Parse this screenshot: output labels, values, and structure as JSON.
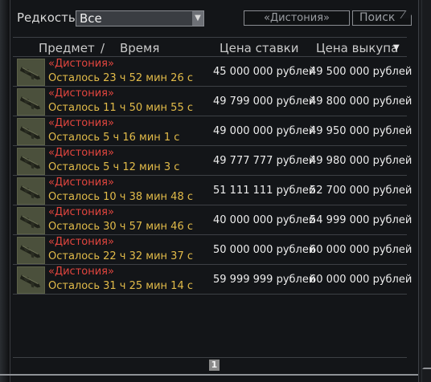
{
  "filters": {
    "rarity_label": "Редкость",
    "rarity_value": "Все",
    "search_value": "«Дистония»",
    "search_button": "Поиск"
  },
  "table": {
    "columns": {
      "item": "Предмет",
      "separator": "/",
      "time": "Время",
      "bid": "Цена ставки",
      "buyout": "Цена выкупа"
    },
    "rows": [
      {
        "name": "«Дистония»",
        "time": "Осталось 23 ч 52 мин 26 с",
        "bid": "45 000 000 рублей",
        "buyout": "49 500 000 рублей"
      },
      {
        "name": "«Дистония»",
        "time": "Осталось 11 ч 50 мин 55 с",
        "bid": "49 799 000 рублей",
        "buyout": "49 800 000 рублей"
      },
      {
        "name": "«Дистония»",
        "time": "Осталось 5 ч 16 мин 1 с",
        "bid": "49 000 000 рублей",
        "buyout": "49 950 000 рублей"
      },
      {
        "name": "«Дистония»",
        "time": "Осталось 5 ч 12 мин 3 с",
        "bid": "49 777 777 рублей",
        "buyout": "49 980 000 рублей"
      },
      {
        "name": "«Дистония»",
        "time": "Осталось 10 ч 38 мин 48 с",
        "bid": "51 111 111 рублей",
        "buyout": "52 700 000 рублей"
      },
      {
        "name": "«Дистония»",
        "time": "Осталось 30 ч 57 мин 46 с",
        "bid": "40 000 000 рублей",
        "buyout": "54 999 000 рублей"
      },
      {
        "name": "«Дистония»",
        "time": "Осталось 22 ч 32 мин 37 с",
        "bid": "50 000 000 рублей",
        "buyout": "60 000 000 рублей"
      },
      {
        "name": "«Дистония»",
        "time": "Осталось 31 ч 25 мин 14 с",
        "bid": "59 999 999 рублей",
        "buyout": "60 000 000 рублей"
      }
    ]
  },
  "pagination": {
    "current_page": "1"
  },
  "colors": {
    "item_name": "#e2453e",
    "time_left": "#e2bb49",
    "price": "#ececec",
    "background": "#131518"
  },
  "icons": {
    "item_thumbnail": "weapon-thumbnail-icon",
    "sort": "sort-descending-icon",
    "dropdown": "dropdown-arrow-icon"
  }
}
